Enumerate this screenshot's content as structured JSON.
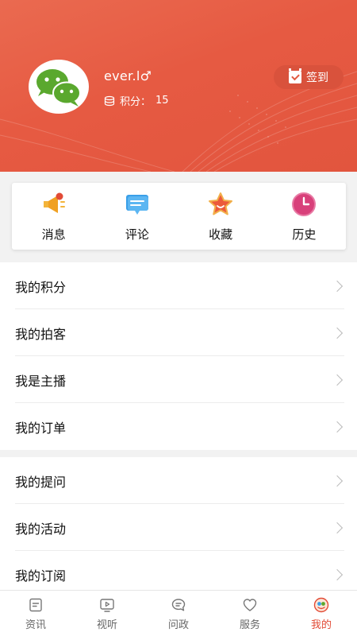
{
  "profile": {
    "username": "ever.l♂",
    "points_label": "积分：",
    "points_value": "15",
    "checkin_label": "签到"
  },
  "quick_actions": [
    {
      "label": "消息",
      "icon": "megaphone-icon"
    },
    {
      "label": "评论",
      "icon": "comment-icon"
    },
    {
      "label": "收藏",
      "icon": "star-icon"
    },
    {
      "label": "历史",
      "icon": "clock-icon"
    }
  ],
  "menu_group_1": [
    {
      "label": "我的积分"
    },
    {
      "label": "我的拍客"
    },
    {
      "label": "我是主播"
    },
    {
      "label": "我的订单"
    }
  ],
  "menu_group_2": [
    {
      "label": "我的提问"
    },
    {
      "label": "我的活动"
    },
    {
      "label": "我的订阅"
    }
  ],
  "bottom_nav": [
    {
      "label": "资讯",
      "icon": "news-icon"
    },
    {
      "label": "视听",
      "icon": "video-icon"
    },
    {
      "label": "问政",
      "icon": "question-chat-icon"
    },
    {
      "label": "服务",
      "icon": "heart-icon"
    },
    {
      "label": "我的",
      "icon": "profile-icon",
      "active": true
    }
  ],
  "colors": {
    "accent": "#e24b36",
    "header": "#e65a42"
  }
}
